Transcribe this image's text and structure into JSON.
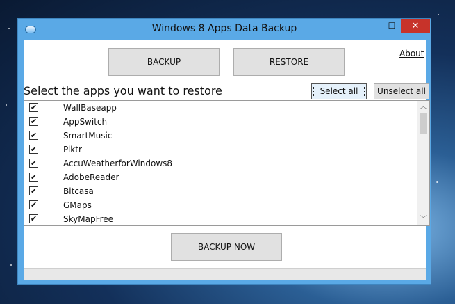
{
  "window": {
    "title": "Windows 8 Apps Data Backup"
  },
  "controls": {
    "minimize": "—",
    "maximize": "☐",
    "close": "✕"
  },
  "toolbar": {
    "backup_label": "BACKUP",
    "restore_label": "RESTORE",
    "about_label": "About"
  },
  "section": {
    "label": "Select the apps you want to restore",
    "select_all_label": "Select all",
    "unselect_all_label": "Unselect all"
  },
  "apps": [
    {
      "name": "WallBaseapp",
      "checked": true
    },
    {
      "name": "AppSwitch",
      "checked": true
    },
    {
      "name": "SmartMusic",
      "checked": true
    },
    {
      "name": "Piktr",
      "checked": true
    },
    {
      "name": "AccuWeatherforWindows8",
      "checked": true
    },
    {
      "name": "AdobeReader",
      "checked": true
    },
    {
      "name": "Bitcasa",
      "checked": true
    },
    {
      "name": "GMaps",
      "checked": true
    },
    {
      "name": "SkyMapFree",
      "checked": true
    }
  ],
  "footer": {
    "backup_now_label": "BACKUP NOW"
  },
  "icons": {
    "app": "app-window-icon",
    "check": "checkmark-icon",
    "scroll_up": "scroll-up-icon",
    "scroll_down": "scroll-down-icon"
  }
}
